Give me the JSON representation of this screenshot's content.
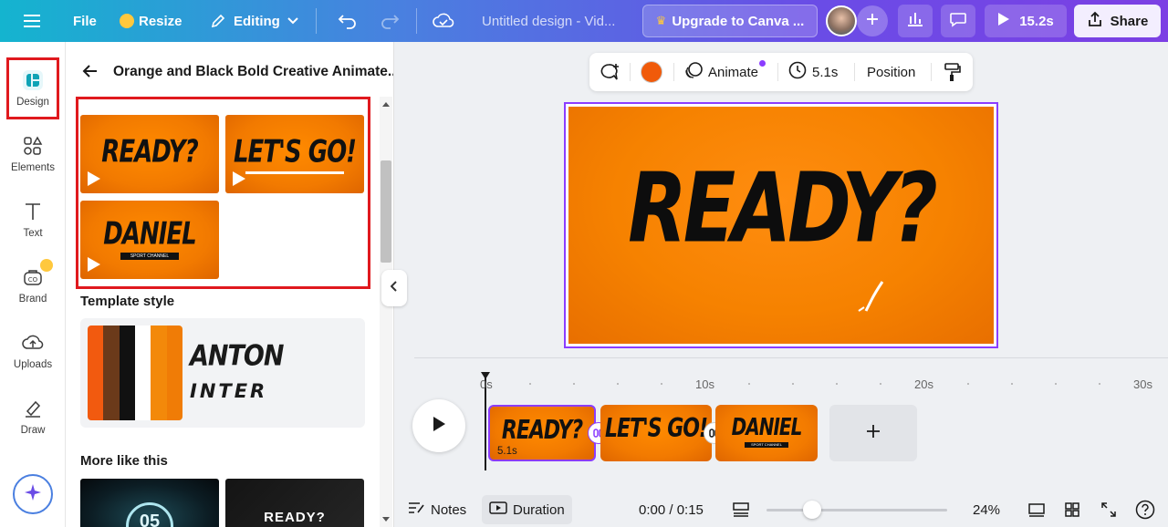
{
  "topbar": {
    "file_label": "File",
    "resize_label": "Resize",
    "editing_label": "Editing",
    "doc_title": "Untitled design - Vid...",
    "upgrade_label": "Upgrade to Canva ...",
    "play_duration": "15.2s",
    "share_label": "Share"
  },
  "sidebar": {
    "items": [
      {
        "label": "Design",
        "icon": "design-icon"
      },
      {
        "label": "Elements",
        "icon": "elements-icon"
      },
      {
        "label": "Text",
        "icon": "text-icon"
      },
      {
        "label": "Brand",
        "icon": "brand-icon"
      },
      {
        "label": "Uploads",
        "icon": "uploads-icon"
      },
      {
        "label": "Draw",
        "icon": "draw-icon"
      }
    ]
  },
  "panel": {
    "title": "Orange and Black Bold Creative Animate...",
    "templates": [
      {
        "text": "READY?"
      },
      {
        "text": "LET'S GO!"
      },
      {
        "text": "DANIEL",
        "sub": "SPORT CHANNEL"
      }
    ],
    "template_style_heading": "Template style",
    "style_font_1": "ANTON",
    "style_font_2": "INTER",
    "style_colors": [
      "#f25a0f",
      "#6b3a1a",
      "#111111",
      "#ffffff",
      "#f3890a",
      "#f07c06"
    ],
    "more_heading": "More like this",
    "more_items": [
      {
        "text": "05"
      },
      {
        "text": "READY?"
      }
    ]
  },
  "toolbar": {
    "color": "#f05a0a",
    "animate_label": "Animate",
    "duration_label": "5.1s",
    "position_label": "Position"
  },
  "canvas": {
    "title": "READY?"
  },
  "timeline": {
    "ticks": [
      "0s",
      "10s",
      "20s",
      "30s"
    ],
    "clips": [
      {
        "text": "READY?",
        "duration": "5.1s"
      },
      {
        "text": "LET'S GO!"
      },
      {
        "text": "DANIEL",
        "sub": "SPORT CHANNEL"
      }
    ]
  },
  "footer": {
    "notes_label": "Notes",
    "duration_label": "Duration",
    "time": "0:00 / 0:15",
    "zoom": "24%"
  },
  "colors": {
    "accent": "#8b3dff",
    "highlight_red": "#e0191e"
  }
}
